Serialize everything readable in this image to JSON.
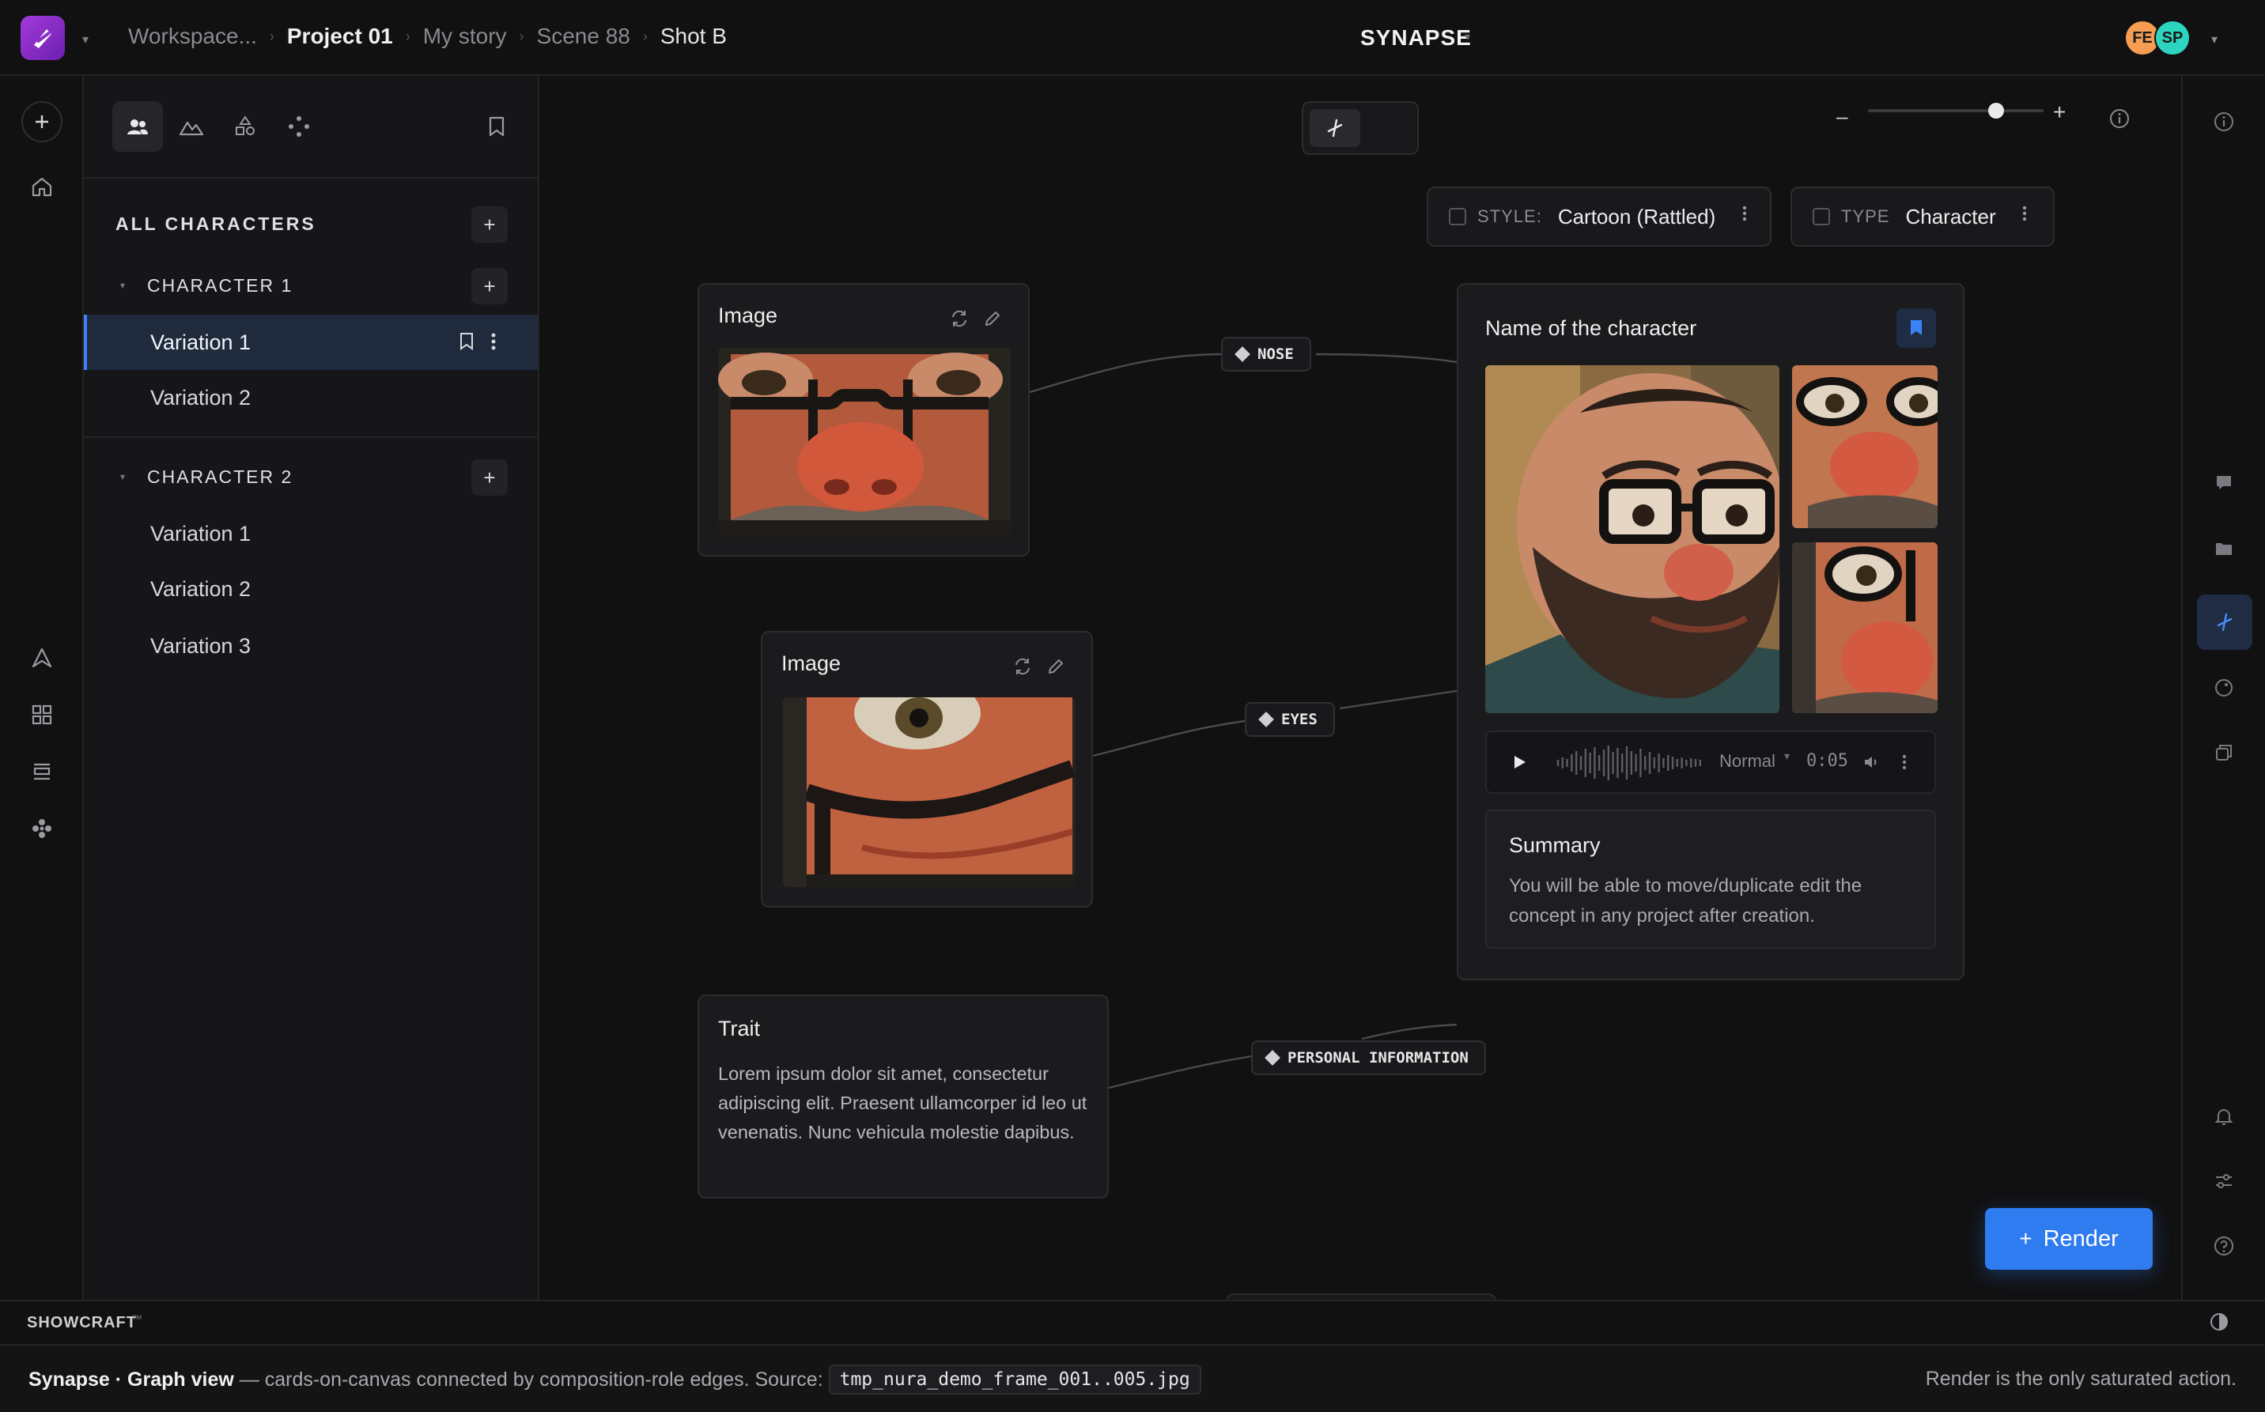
{
  "header": {
    "breadcrumbs": [
      "Workspace...",
      "Project 01",
      "My story",
      "Scene 88",
      "Shot B"
    ],
    "app_title": "SYNAPSE",
    "avatars": [
      {
        "initials": "FE",
        "color": "#f59e52"
      },
      {
        "initials": "SP",
        "color": "#2dd4bf"
      }
    ]
  },
  "sidebar": {
    "section_title": "ALL CHARACTERS",
    "groups": [
      {
        "title": "CHARACTER 1",
        "variations": [
          "Variation 1",
          "Variation 2"
        ],
        "selected": "Variation 1"
      },
      {
        "title": "CHARACTER 2",
        "variations": [
          "Variation 1",
          "Variation 2",
          "Variation 3"
        ]
      }
    ],
    "tab_icons": [
      "people-icon",
      "mountain-icon",
      "shapes-icon",
      "graph-dots-icon"
    ]
  },
  "canvas": {
    "zoom_level": 0.75,
    "filters": {
      "style": {
        "key": "STYLE:",
        "value": "Cartoon (Rattled)"
      },
      "type": {
        "key": "TYPE",
        "value": "Character"
      }
    },
    "image_cards": [
      {
        "title": "Image",
        "edge_label": "NOSE"
      },
      {
        "title": "Image",
        "edge_label": "EYES"
      }
    ],
    "trait_card": {
      "title": "Trait",
      "body": "Lorem ipsum dolor sit amet, consectetur adipiscing elit. Praesent ullamcorper id leo ut venenatis. Nunc vehicula molestie dapibus.",
      "edge_label": "PERSONAL INFORMATION"
    },
    "character_card": {
      "title": "Name of the character",
      "audio": {
        "speed": "Normal",
        "time": "0:05"
      },
      "summary_title": "Summary",
      "summary_body": "You will be able to move/duplicate edit the concept in any project after creation."
    },
    "render_label": "Render"
  },
  "footer": {
    "brand": "SHOWCRAFT",
    "brand_mark": "™",
    "caption_app": "Synapse · Graph view",
    "caption_text": " — cards-on-canvas connected by composition-role edges. Source: ",
    "caption_source": "tmp_nura_demo_frame_001..005.jpg",
    "caption_right": "Render is the only saturated action."
  },
  "colors": {
    "accent": "#2f7bf0",
    "brand": "#8b2fc9",
    "background": "#111112"
  }
}
